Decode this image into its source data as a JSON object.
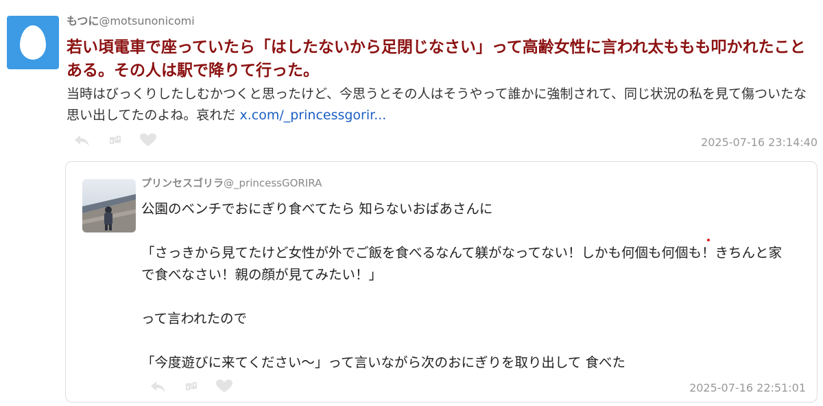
{
  "post": {
    "display_name": "もつに",
    "handle": "@motsunonicomi",
    "title": "若い頃電車で座っていたら「はしたないから足閉じなさい」って高齢女性に言われ太ももも叩かれたことある。その人は駅で降りて行った。",
    "body": "当時はびっくりしたしむかつくと思ったけど、今思うとその人はそうやって誰かに強制されて、同じ状況の私を見て傷ついたな思い出してたのよね。哀れだ",
    "link_text": "x.com/_princessgorir...",
    "timestamp": "2025-07-16 23:14:40",
    "avatar_icon": "egg-icon",
    "avatar_color": "#3d9be5",
    "title_color": "#8b1111"
  },
  "quote": {
    "display_name": "プリンセスゴリラ",
    "handle": "@_princessGORIRA",
    "lines": [
      "公園のベンチでおにぎり食べてたら 知らないおばあさんに",
      "",
      "「さっきから見てたけど女性が外でご飯を食べるなんて躾がなってない！しかも何個も何個も！きちんと家で食べなさい！親の顔が見てみたい！」",
      "",
      "って言われたので",
      "",
      "「今度遊びに来てください〜」って言いながら次のおにぎりを取り出して 食べた"
    ],
    "timestamp": "2025-07-16 22:51:01"
  },
  "actions": {
    "reply_icon": "reply-icon",
    "retweet_icon": "retweet-icon",
    "like_icon": "heart-icon"
  }
}
